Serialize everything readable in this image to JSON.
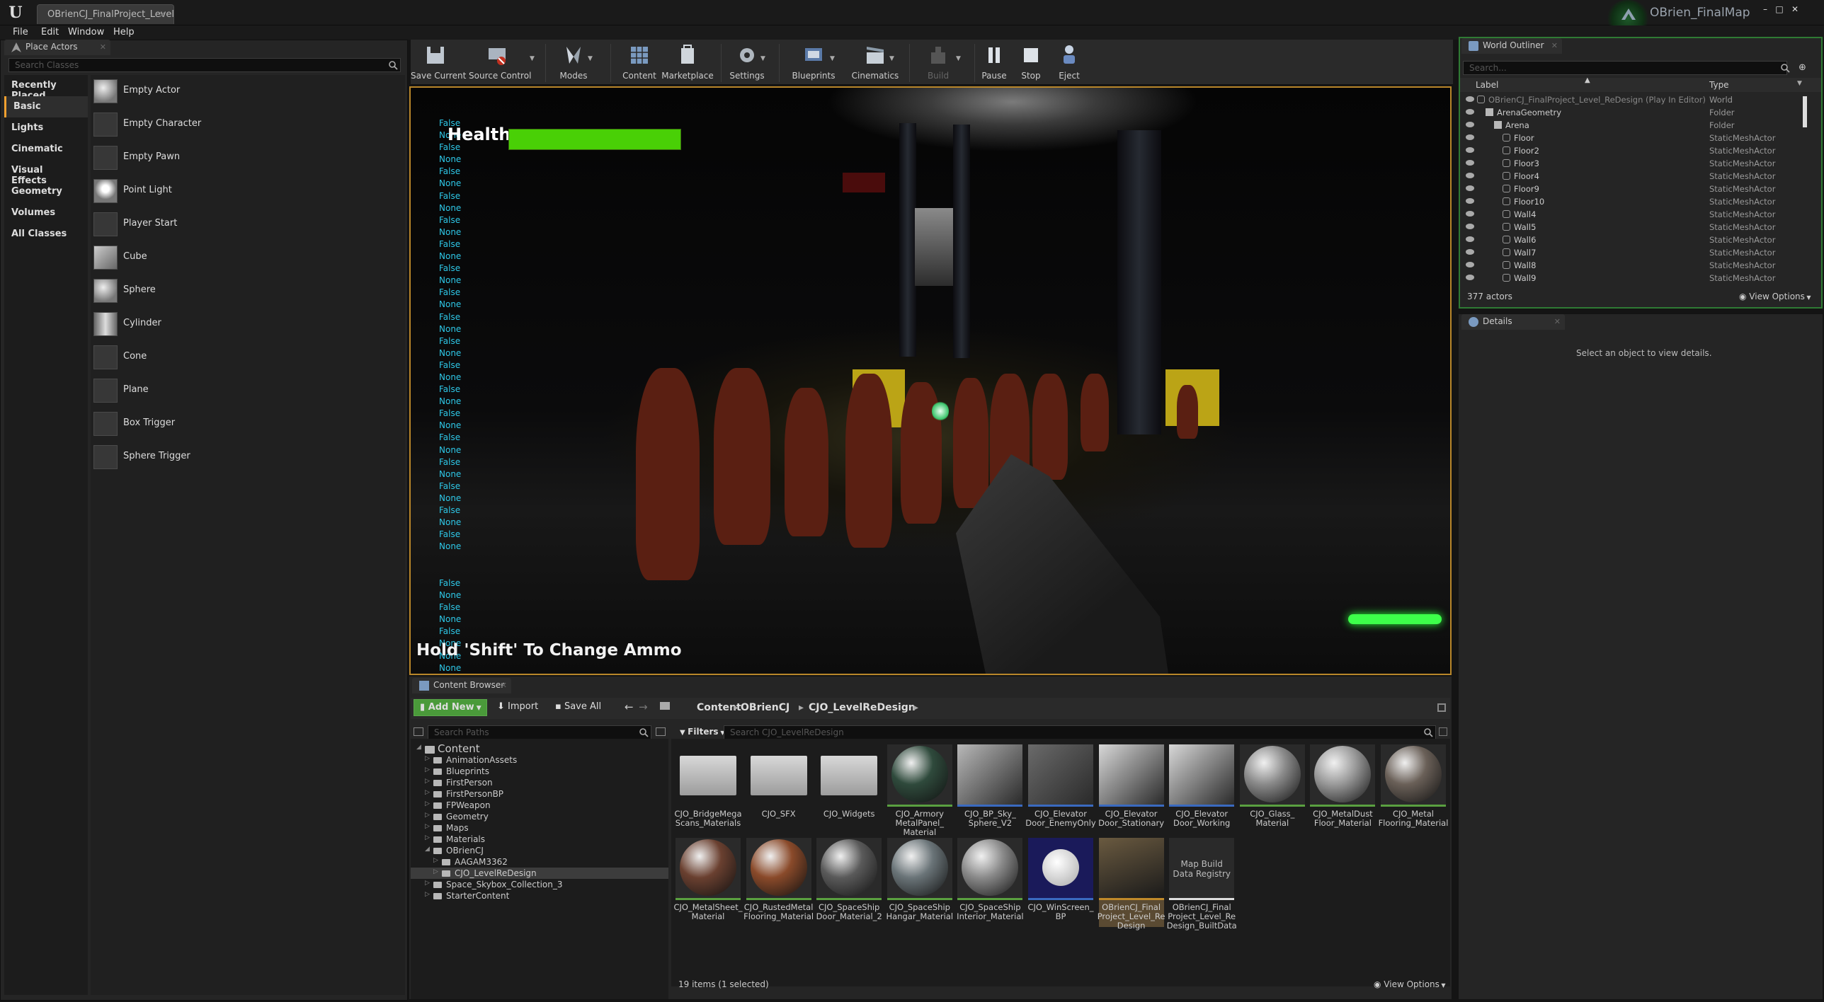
{
  "window": {
    "doc_tab": "OBrienCJ_FinalProject_Level",
    "project_name": "OBrien_FinalMap"
  },
  "menu": [
    "File",
    "Edit",
    "Window",
    "Help"
  ],
  "place_actors": {
    "tab": "Place Actors",
    "search_placeholder": "Search Classes",
    "categories": [
      "Recently Placed",
      "Basic",
      "Lights",
      "Cinematic",
      "Visual Effects",
      "Geometry",
      "Volumes",
      "All Classes"
    ],
    "selected_category": "Basic",
    "actors": [
      "Empty Actor",
      "Empty Character",
      "Empty Pawn",
      "Point Light",
      "Player Start",
      "Cube",
      "Sphere",
      "Cylinder",
      "Cone",
      "Plane",
      "Box Trigger",
      "Sphere Trigger"
    ]
  },
  "toolbar": {
    "buttons": [
      "Save Current",
      "Source Control",
      "Modes",
      "Content",
      "Marketplace",
      "Settings",
      "Blueprints",
      "Cinematics",
      "Build",
      "Pause",
      "Stop",
      "Eject"
    ]
  },
  "viewport": {
    "health_label": "Health:",
    "health_fraction": 1.0,
    "debug_lines_top": [
      "False",
      "None",
      "False",
      "None",
      "False",
      "None",
      "False",
      "None",
      "False",
      "None",
      "False",
      "None",
      "False",
      "None",
      "False",
      "None",
      "False",
      "None",
      "False",
      "None",
      "False",
      "None",
      "False",
      "None",
      "False",
      "None",
      "False",
      "None",
      "False",
      "None",
      "False",
      "None",
      "False",
      "None",
      "False",
      "None"
    ],
    "debug_lines_bottom": [
      "False",
      "None",
      "False",
      "None",
      "False",
      "None",
      "None",
      "None"
    ],
    "hint": "Hold 'Shift' To Change Ammo"
  },
  "content_browser": {
    "tab": "Content Browser",
    "add_new": "Add New",
    "import": "Import",
    "save_all": "Save All",
    "breadcrumb": [
      "Content",
      "OBrienCJ",
      "CJO_LevelReDesign"
    ],
    "search_paths_placeholder": "Search Paths",
    "filters": "Filters",
    "search_assets_placeholder": "Search CJO_LevelReDesign",
    "tree": [
      {
        "label": "Content",
        "depth": 0,
        "expanded": true
      },
      {
        "label": "AnimationAssets",
        "depth": 1
      },
      {
        "label": "Blueprints",
        "depth": 1
      },
      {
        "label": "FirstPerson",
        "depth": 1
      },
      {
        "label": "FirstPersonBP",
        "depth": 1
      },
      {
        "label": "FPWeapon",
        "depth": 1
      },
      {
        "label": "Geometry",
        "depth": 1
      },
      {
        "label": "Maps",
        "depth": 1
      },
      {
        "label": "Materials",
        "depth": 1
      },
      {
        "label": "OBrienCJ",
        "depth": 1,
        "expanded": true
      },
      {
        "label": "AAGAM3362",
        "depth": 2
      },
      {
        "label": "CJO_LevelReDesign",
        "depth": 2,
        "selected": true
      },
      {
        "label": "Space_Skybox_Collection_3",
        "depth": 1
      },
      {
        "label": "StarterContent",
        "depth": 1
      }
    ],
    "assets": [
      {
        "label": "CJO_BridgeMega Scans_Materials",
        "kind": "folder"
      },
      {
        "label": "CJO_SFX",
        "kind": "folder"
      },
      {
        "label": "CJO_Widgets",
        "kind": "folder"
      },
      {
        "label": "CJO_Armory MetalPanel_ Material",
        "kind": "material",
        "color": "#2f4a3c"
      },
      {
        "label": "CJO_BP_Sky_ Sphere_V2",
        "kind": "blueprint",
        "color": "#b8b8b8"
      },
      {
        "label": "CJO_Elevator Door_EnemyOnly",
        "kind": "blueprint",
        "color": "#6a6a6a"
      },
      {
        "label": "CJO_Elevator Door_Stationary",
        "kind": "blueprint",
        "color": "#d8d8d8"
      },
      {
        "label": "CJO_Elevator Door_Working",
        "kind": "blueprint",
        "color": "#d8d8d8"
      },
      {
        "label": "CJO_Glass_ Material",
        "kind": "material",
        "color": "#8a8a8a"
      },
      {
        "label": "CJO_MetalDust Floor_Material",
        "kind": "material",
        "color": "#9a9a9a"
      },
      {
        "label": "CJO_Metal Flooring_Material",
        "kind": "material",
        "color": "#6a6058"
      },
      {
        "label": "CJO_MetalSheet_ Material",
        "kind": "material",
        "color": "#6a4030"
      },
      {
        "label": "CJO_RustedMetal Flooring_Material",
        "kind": "material",
        "color": "#8a4a2a"
      },
      {
        "label": "CJO_SpaceShip Door_Material_2",
        "kind": "material",
        "color": "#5a5a5a"
      },
      {
        "label": "CJO_SpaceShip Hangar_Material",
        "kind": "material",
        "color": "#6a7478"
      },
      {
        "label": "CJO_SpaceShip Interior_Material",
        "kind": "material",
        "color": "#8a8a8a"
      },
      {
        "label": "CJO_WinScreen_ BP",
        "kind": "widget",
        "color": "#f0f0f0"
      },
      {
        "label": "OBrienCJ_Final Project_Level_Re Design",
        "kind": "level",
        "color": "#4a3a22"
      },
      {
        "label": "OBrienCJ_Final Project_Level_Re Design_BuiltData",
        "kind": "registry",
        "thumb_text": "Map Build Data Registry"
      }
    ],
    "status": "19 items (1 selected)",
    "view_options": "View Options"
  },
  "outliner": {
    "tab": "World Outliner",
    "search_placeholder": "Search...",
    "col_label": "Label",
    "col_type": "Type",
    "rows": [
      {
        "label": "OBrienCJ_FinalProject_Level_ReDesign (Play In Editor)",
        "type": "World",
        "depth": 0,
        "dim": true
      },
      {
        "label": "ArenaGeometry",
        "type": "Folder",
        "depth": 1
      },
      {
        "label": "Arena",
        "type": "Folder",
        "depth": 2
      },
      {
        "label": "Floor",
        "type": "StaticMeshActor",
        "depth": 3
      },
      {
        "label": "Floor2",
        "type": "StaticMeshActor",
        "depth": 3
      },
      {
        "label": "Floor3",
        "type": "StaticMeshActor",
        "depth": 3
      },
      {
        "label": "Floor4",
        "type": "StaticMeshActor",
        "depth": 3
      },
      {
        "label": "Floor9",
        "type": "StaticMeshActor",
        "depth": 3
      },
      {
        "label": "Floor10",
        "type": "StaticMeshActor",
        "depth": 3
      },
      {
        "label": "Wall4",
        "type": "StaticMeshActor",
        "depth": 3
      },
      {
        "label": "Wall5",
        "type": "StaticMeshActor",
        "depth": 3
      },
      {
        "label": "Wall6",
        "type": "StaticMeshActor",
        "depth": 3
      },
      {
        "label": "Wall7",
        "type": "StaticMeshActor",
        "depth": 3
      },
      {
        "label": "Wall8",
        "type": "StaticMeshActor",
        "depth": 3
      },
      {
        "label": "Wall9",
        "type": "StaticMeshActor",
        "depth": 3
      }
    ],
    "count": "377 actors",
    "view_options": "View Options"
  },
  "details": {
    "tab": "Details",
    "empty_message": "Select an object to view details."
  },
  "colors": {
    "accent_orange": "#f0a030",
    "viewport_border": "#b8862a",
    "outliner_border": "#2f7a34",
    "add_new_green": "#4a9a3a",
    "health_green": "#49d006",
    "debug_text": "#2ec8e8"
  }
}
